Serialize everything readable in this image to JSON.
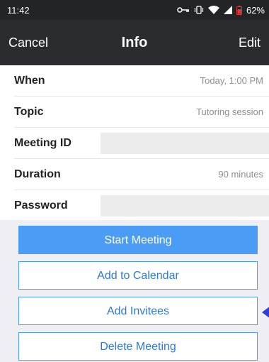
{
  "status_bar": {
    "time": "11:42",
    "battery": "62%",
    "icons": [
      "key-icon",
      "vibrate-icon",
      "wifi-icon",
      "signal-icon",
      "battery-icon"
    ]
  },
  "nav": {
    "left": "Cancel",
    "title": "Info",
    "right": "Edit"
  },
  "rows": [
    {
      "label": "When",
      "value": "Today, 1:00 PM"
    },
    {
      "label": "Topic",
      "value": "Tutoring session"
    },
    {
      "label": "Meeting ID",
      "value": ""
    },
    {
      "label": "Duration",
      "value": "90 minutes"
    },
    {
      "label": "Password",
      "value": ""
    }
  ],
  "buttons": {
    "start": "Start Meeting",
    "calendar": "Add to Calendar",
    "invitees": "Add Invitees",
    "delete": "Delete Meeting"
  },
  "colors": {
    "primary": "#4a9cf5",
    "link": "#2e79d6",
    "nav_bg": "#2a2c2e",
    "pointer": "#2e3fd6"
  }
}
